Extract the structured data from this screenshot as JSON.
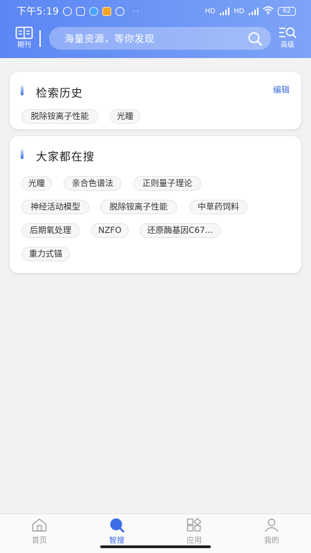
{
  "status_bar": {
    "time": "下午5:19",
    "network_left": "HD",
    "network_right": "HD",
    "battery": "62",
    "dots": "··"
  },
  "header": {
    "journal_label": "期刊",
    "search_placeholder": "海量资源，等你发现",
    "advanced_label": "高级"
  },
  "history": {
    "title": "检索历史",
    "edit_label": "编辑",
    "items": [
      "脱除铵离子性能",
      "光瞳"
    ]
  },
  "hot": {
    "title": "大家都在搜",
    "items": [
      "光瞳",
      "亲合色谱法",
      "正则量子理论",
      "神经活动模型",
      "脱除铵离子性能",
      "中草药饲料",
      "后期氧处理",
      "NZFO",
      "还原酶基因C67...",
      "重力式锚"
    ]
  },
  "tabbar": {
    "tabs": [
      {
        "label": "首页",
        "icon": "home-icon"
      },
      {
        "label": "智搜",
        "icon": "smart-search-icon"
      },
      {
        "label": "应用",
        "icon": "apps-icon"
      },
      {
        "label": "我的",
        "icon": "profile-icon"
      }
    ],
    "active_index": 1
  },
  "colors": {
    "accent": "#3f6de8",
    "header_start": "#5b86f4",
    "header_end": "#7ea4f7",
    "background": "#f2f2f2"
  }
}
